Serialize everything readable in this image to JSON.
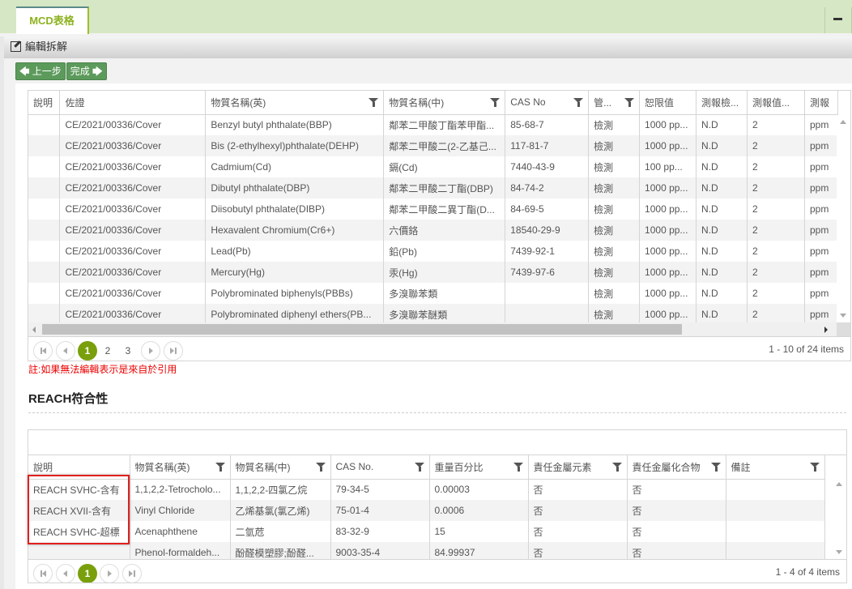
{
  "tabs": [
    {
      "label": "MCD表格",
      "active": true
    }
  ],
  "window": {
    "minimize_icon": "minus-icon"
  },
  "panel": {
    "title": "編輯拆解",
    "icon": "edit-icon"
  },
  "toolbar": {
    "prev_label": "上一步",
    "done_label": "完成"
  },
  "mcd_grid": {
    "columns": [
      "說明",
      "佐證",
      "物質名稱(英)",
      "物質名稱(中)",
      "CAS No",
      "管...",
      "恕限值",
      "測報檢...",
      "測報值...",
      "測報"
    ],
    "rows": [
      [
        "",
        "CE/2021/00336/Cover",
        "Benzyl butyl phthalate(BBP)",
        "鄰苯二甲酸丁酯苯甲酯...",
        "85-68-7",
        "檢測",
        "1000 pp...",
        "N.D",
        "2",
        "ppm"
      ],
      [
        "",
        "CE/2021/00336/Cover",
        "Bis (2-ethylhexyl)phthalate(DEHP)",
        "鄰苯二甲酸二(2-乙基己...",
        "117-81-7",
        "檢測",
        "1000 pp...",
        "N.D",
        "2",
        "ppm"
      ],
      [
        "",
        "CE/2021/00336/Cover",
        "Cadmium(Cd)",
        "鎘(Cd)",
        "7440-43-9",
        "檢測",
        "100 pp...",
        "N.D",
        "2",
        "ppm"
      ],
      [
        "",
        "CE/2021/00336/Cover",
        "Dibutyl phthalate(DBP)",
        "鄰苯二甲酸二丁酯(DBP)",
        "84-74-2",
        "檢測",
        "1000 pp...",
        "N.D",
        "2",
        "ppm"
      ],
      [
        "",
        "CE/2021/00336/Cover",
        "Diisobutyl phthalate(DIBP)",
        "鄰苯二甲酸二異丁酯(D...",
        "84-69-5",
        "檢測",
        "1000 pp...",
        "N.D",
        "2",
        "ppm"
      ],
      [
        "",
        "CE/2021/00336/Cover",
        "Hexavalent Chromium(Cr6+)",
        "六價鉻",
        "18540-29-9",
        "檢測",
        "1000 pp...",
        "N.D",
        "2",
        "ppm"
      ],
      [
        "",
        "CE/2021/00336/Cover",
        "Lead(Pb)",
        "鉛(Pb)",
        "7439-92-1",
        "檢測",
        "1000 pp...",
        "N.D",
        "2",
        "ppm"
      ],
      [
        "",
        "CE/2021/00336/Cover",
        "Mercury(Hg)",
        "汞(Hg)",
        "7439-97-6",
        "檢測",
        "1000 pp...",
        "N.D",
        "2",
        "ppm"
      ],
      [
        "",
        "CE/2021/00336/Cover",
        "Polybrominated biphenyls(PBBs)",
        "多溴聯苯類",
        "",
        "檢測",
        "1000 pp...",
        "N.D",
        "2",
        "ppm"
      ],
      [
        "",
        "CE/2021/00336/Cover",
        "Polybrominated diphenyl ethers(PB...",
        "多溴聯苯醚類",
        "",
        "檢測",
        "1000 pp...",
        "N.D",
        "2",
        "ppm"
      ]
    ],
    "pager": {
      "pages": [
        "1",
        "2",
        "3"
      ],
      "current": "1",
      "info": "1 - 10 of 24 items"
    }
  },
  "note": "註:如果無法編輯表示是來自於引用",
  "reach": {
    "title": "REACH符合性",
    "columns": [
      "說明",
      "物質名稱(英)",
      "物質名稱(中)",
      "CAS No.",
      "重量百分比",
      "責任金屬元素",
      "責任金屬化合物",
      "備註"
    ],
    "rows": [
      [
        "REACH SVHC-含有",
        "1,1,2,2-Tetrocholo...",
        "1,1,2,2-四氯乙烷",
        "79-34-5",
        "0.00003",
        "否",
        "否",
        ""
      ],
      [
        "REACH XVII-含有",
        "Vinyl Chloride",
        "乙烯基氯(氯乙烯)",
        "75-01-4",
        "0.0006",
        "否",
        "否",
        ""
      ],
      [
        "REACH SVHC-超標",
        "Acenaphthene",
        "二氫苊",
        "83-32-9",
        "15",
        "否",
        "否",
        ""
      ],
      [
        "",
        "Phenol-formaldeh...",
        "酚醛模塑膠;酚醛...",
        "9003-35-4",
        "84.99937",
        "否",
        "否",
        ""
      ]
    ],
    "pager": {
      "pages": [
        "1"
      ],
      "current": "1",
      "info": "1 - 4 of 4 items"
    }
  },
  "colors": {
    "tab_bar": "#d6e7c5",
    "tab_text": "#8cb21f",
    "button": "#5c9a5c",
    "pager_active": "#7a9f0c",
    "link": "#2a5e9c",
    "note": "#ee0000",
    "highlight": "#e02020"
  }
}
